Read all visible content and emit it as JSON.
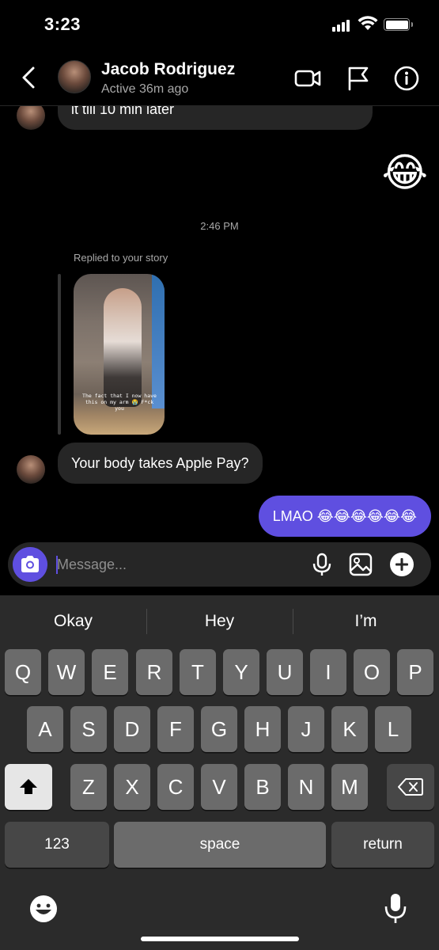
{
  "status_bar": {
    "time": "3:23"
  },
  "header": {
    "contact_name": "Jacob Rodriguez",
    "contact_status": "Active 36m ago"
  },
  "messages": {
    "partial_incoming": "it till 10 min later",
    "reaction_emoji": "😂",
    "timestamp": "2:46 PM",
    "replied_label": "Replied to your story",
    "story_caption": "The fact that I now have this on my arm 😭 F*ck you",
    "incoming": "Your body takes Apple Pay?",
    "outgoing": "LMAO 😂😂😂😂😂😂"
  },
  "composer": {
    "placeholder": "Message..."
  },
  "keyboard": {
    "suggestions": [
      "Okay",
      "Hey",
      "I’m"
    ],
    "row1": [
      "Q",
      "W",
      "E",
      "R",
      "T",
      "Y",
      "U",
      "I",
      "O",
      "P"
    ],
    "row2": [
      "A",
      "S",
      "D",
      "F",
      "G",
      "H",
      "J",
      "K",
      "L"
    ],
    "row3": [
      "Z",
      "X",
      "C",
      "V",
      "B",
      "N",
      "M"
    ],
    "numbers_label": "123",
    "space_label": "space",
    "return_label": "return"
  },
  "colors": {
    "accent": "#5f4fe0",
    "incoming_bubble": "#262626",
    "keyboard_bg": "#2b2b2b",
    "key_bg": "#6b6b6b"
  }
}
